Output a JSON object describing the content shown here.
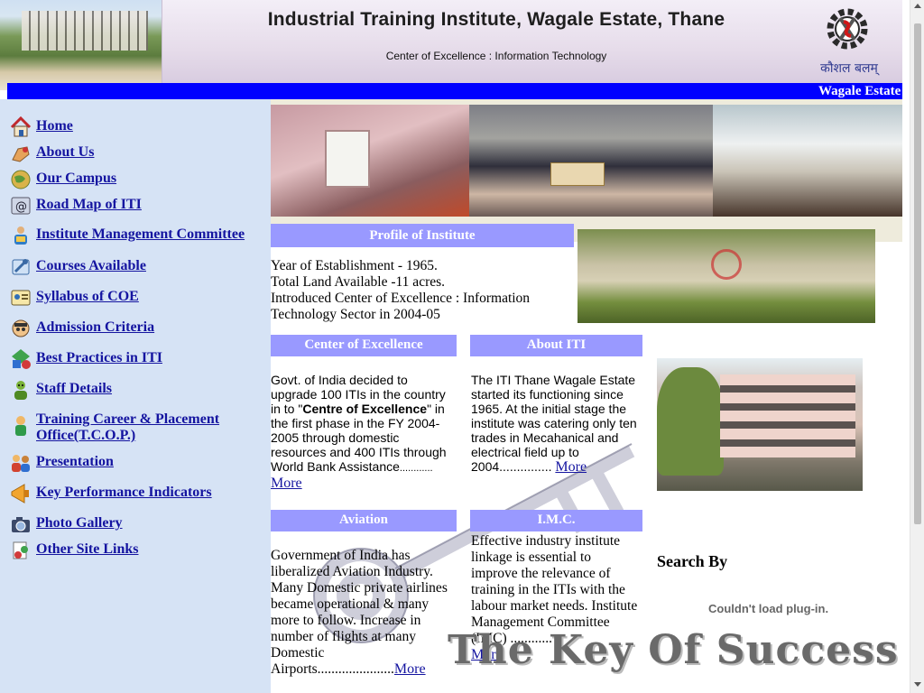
{
  "header": {
    "title": "Industrial Training Institute, Wagale Estate, Thane",
    "subtitle": "Center of Excellence : Information Technology",
    "logo_text": "कौशल बलम्"
  },
  "marquee": {
    "text": "Wagale Estate"
  },
  "sidebar": {
    "items": [
      {
        "label": "Home",
        "icon": "home-icon"
      },
      {
        "label": "About Us",
        "icon": "hand-icon"
      },
      {
        "label": "Our Campus",
        "icon": "globe-icon"
      },
      {
        "label": "Road Map of ITI",
        "icon": "at-sign-icon"
      },
      {
        "label": "Institute Management Committee",
        "icon": "person-book-icon"
      },
      {
        "label": "Courses Available",
        "icon": "tools-icon"
      },
      {
        "label": "Syllabus of COE",
        "icon": "id-card-icon"
      },
      {
        "label": "Admission Criteria",
        "icon": "student-icon"
      },
      {
        "label": "Best Practices in ITI",
        "icon": "shapes-icon"
      },
      {
        "label": "Staff Details",
        "icon": "person-green-icon"
      },
      {
        "label": "Training Career & Placement Office(T.C.O.P.)",
        "icon": "person-icon"
      },
      {
        "label": "Presentation",
        "icon": "people-icon"
      },
      {
        "label": "Key Performance Indicators",
        "icon": "megaphone-icon"
      },
      {
        "label": "Photo Gallery",
        "icon": "camera-icon"
      },
      {
        "label": "Other Site Links",
        "icon": "links-icon"
      }
    ]
  },
  "profile": {
    "heading": "Profile of Institute",
    "lines": [
      "Year of Establishment - 1965.",
      "Total Land Available -11 acres.",
      "Introduced Center of Excellence : Information Technology Sector in 2004-05"
    ]
  },
  "coe": {
    "heading": "Center of Excellence",
    "text_before": " Govt. of India decided to upgrade 100 ITIs in the country in to \"",
    "text_bold": "Centre of Excellence",
    "text_after": "\" in the first phase in the FY 2004-2005 through domestic resources and 400 ITIs through World Bank Assistance",
    "dots": "............",
    "more": "More"
  },
  "about": {
    "heading": "About ITI",
    "text": "The ITI Thane Wagale Estate started its functioning since 1965. At the initial stage the institute was catering only ten trades in Mecahanical and electrical field up to 2004...............",
    "more": "More"
  },
  "aviation": {
    "heading": "Aviation",
    "text": "Government of India has liberalized Aviation Industry. Many Domestic private airlines became operational & many more to follow. Increase in number of flights at many Domestic Airports......................",
    "more": "More"
  },
  "imc": {
    "heading": "I.M.C.",
    "text": "Effective industry institute linkage is essential to improve the relevance of training in the ITIs with the labour market needs. Institute Management Committee (IMC) ............",
    "more": "More"
  },
  "search": {
    "label": "Search By",
    "plugin_message": "Couldn't load plug-in."
  },
  "watermark": {
    "text": "The Key Of Success"
  },
  "colors": {
    "marquee_bg": "#0000ff",
    "section_heading_bg": "#9999ff",
    "sidebar_bg": "#d6e3f5",
    "link": "#1414a0"
  }
}
